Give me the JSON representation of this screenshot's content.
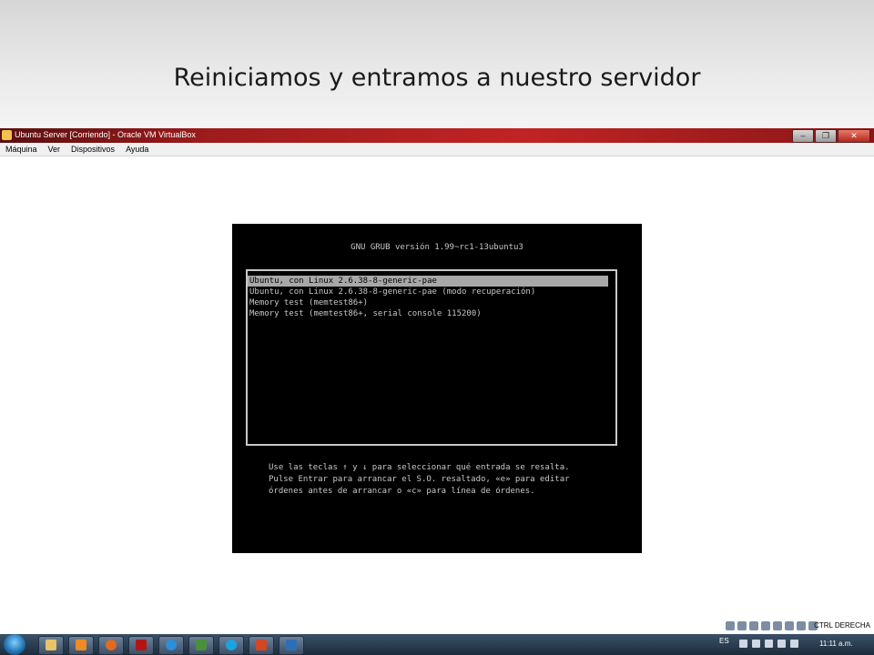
{
  "slide": {
    "title": "Reiniciamos y entramos a nuestro servidor"
  },
  "window": {
    "title": "Ubuntu Server [Corriendo] - Oracle VM VirtualBox",
    "controls": {
      "minimize": "–",
      "restore": "❐",
      "close": "✕"
    }
  },
  "menu": {
    "items": [
      "Máquina",
      "Ver",
      "Dispositivos",
      "Ayuda"
    ]
  },
  "grub": {
    "header": "GNU GRUB versión 1.99~rc1-13ubuntu3",
    "entries": [
      "Ubuntu, con Linux 2.6.38-8-generic-pae",
      "Ubuntu, con Linux 2.6.38-8-generic-pae (modo recuperación)",
      "Memory test (memtest86+)",
      "Memory test (memtest86+, serial console 115200)"
    ],
    "selected_index": 0,
    "help": [
      "Use las teclas ↑ y ↓ para seleccionar qué entrada se resalta.",
      "Pulse Entrar para arrancar el S.O. resaltado, «e» para editar",
      "órdenes antes de arrancar o «c» para línea de órdenes."
    ]
  },
  "status": {
    "host_key": "CTRL DERECHA"
  },
  "taskbar": {
    "language": "ES",
    "clock": "11:11 a.m.",
    "apps": [
      "explorer-icon",
      "media-player-icon",
      "firefox-icon",
      "reader-icon",
      "internet-explorer-icon",
      "dreamweaver-icon",
      "skype-icon",
      "powerpoint-icon",
      "virtualbox-icon"
    ]
  },
  "colors": {
    "titlebar": "#a01c1c",
    "grub_bg": "#000000",
    "grub_text": "#c8c8c8",
    "grub_selection": "#a8a8a8"
  }
}
